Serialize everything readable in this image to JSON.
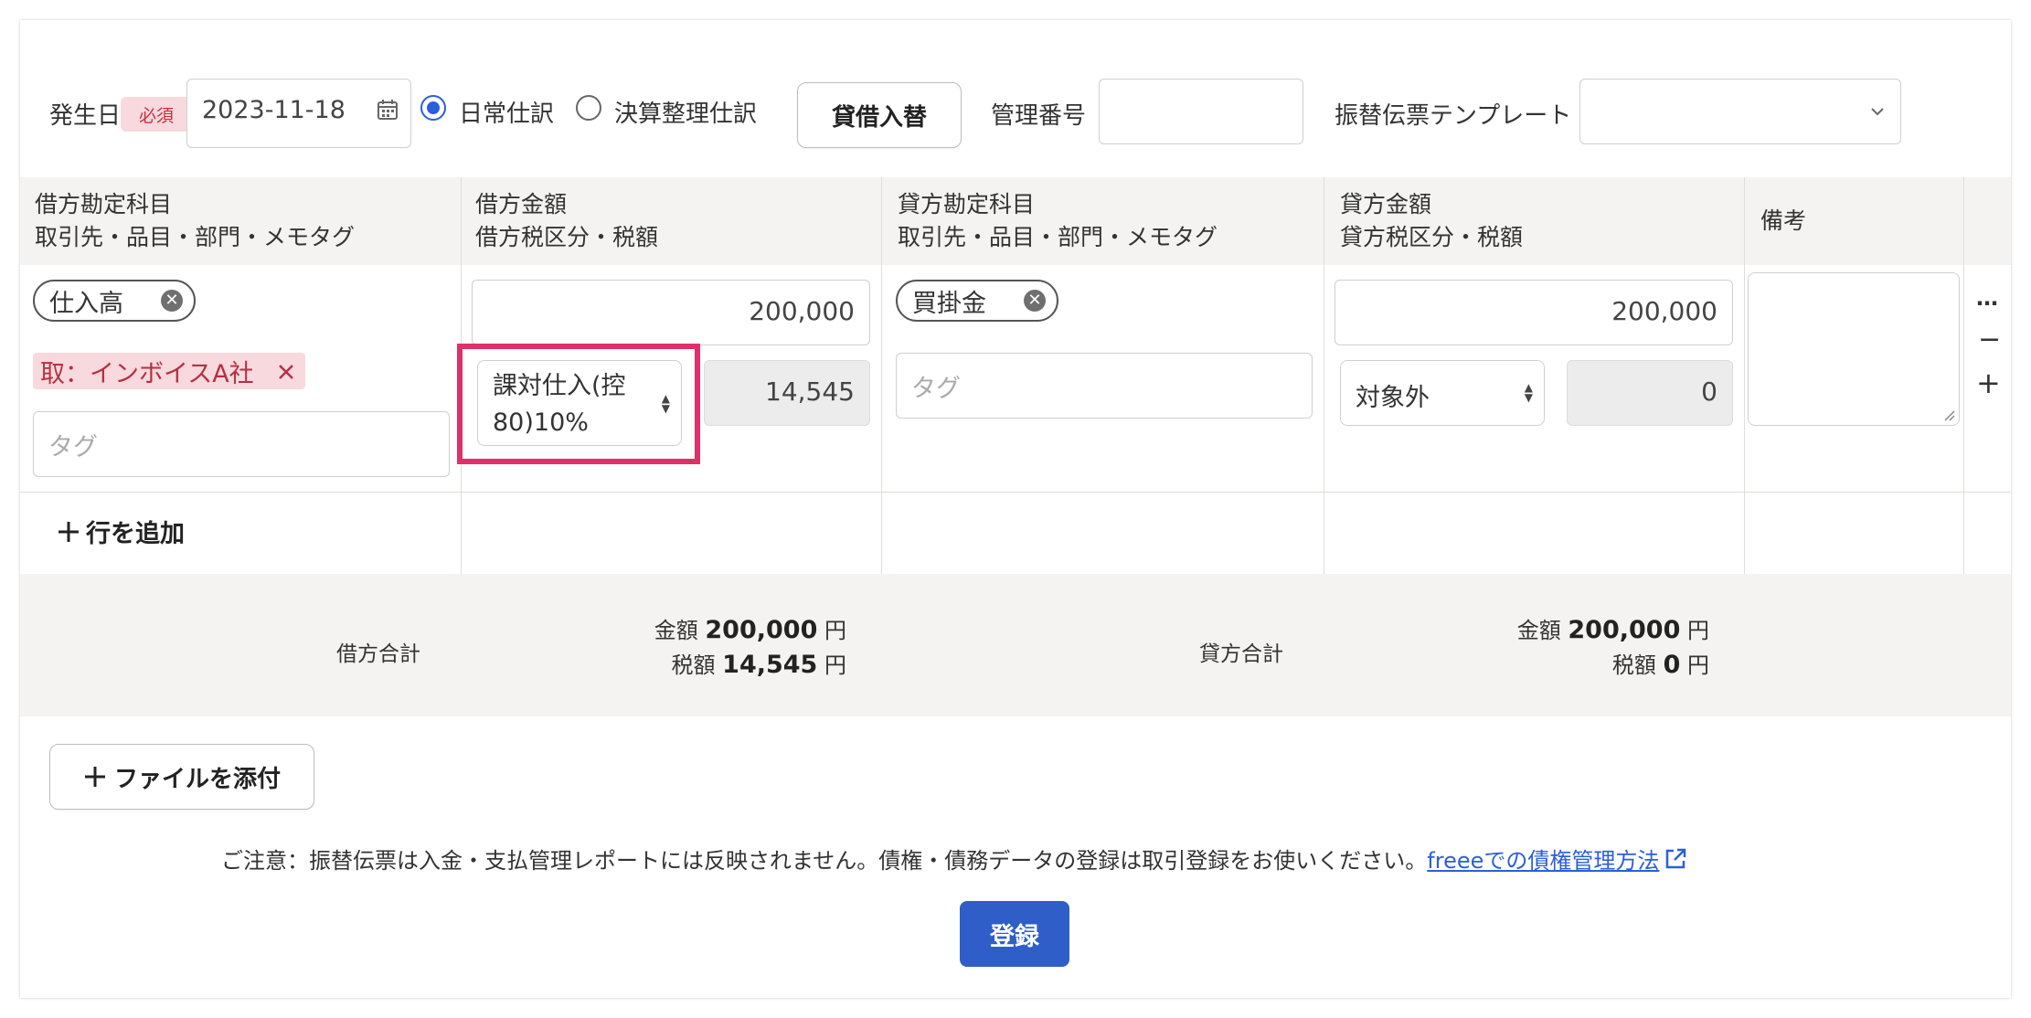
{
  "header": {
    "date_label": "発生日",
    "required_badge": "必須",
    "date_value": "2023-11-18",
    "entry_type_options": [
      "日常仕訳",
      "決算整理仕訳"
    ],
    "entry_type_selected": "日常仕訳",
    "swap_button": "貸借入替",
    "management_number_label": "管理番号",
    "management_number_value": "",
    "template_label": "振替伝票テンプレート",
    "template_value": ""
  },
  "table": {
    "columns": [
      {
        "line1": "借方勘定科目",
        "line2": "取引先・品目・部門・メモタグ"
      },
      {
        "line1": "借方金額",
        "line2": "借方税区分・税額"
      },
      {
        "line1": "貸方勘定科目",
        "line2": "取引先・品目・部門・メモタグ"
      },
      {
        "line1": "貸方金額",
        "line2": "貸方税区分・税額"
      },
      {
        "line1": "備考",
        "line2": ""
      }
    ],
    "row": {
      "debit_account": "仕入高",
      "debit_partner_tag": "取：インボイスA社",
      "debit_tag_placeholder": "タグ",
      "debit_amount": "200,000",
      "debit_tax_category": "課対仕入(控80)10%",
      "debit_tax_category_line1": "課対仕入(控",
      "debit_tax_category_line2": "80)10%",
      "debit_tax_amount": "14,545",
      "credit_account": "買掛金",
      "credit_tag_placeholder": "タグ",
      "credit_amount": "200,000",
      "credit_tax_category": "対象外",
      "credit_tax_amount": "0",
      "memo": ""
    },
    "row_actions": {
      "more": "…",
      "remove": "−",
      "add": "+"
    },
    "add_row": "行を追加"
  },
  "totals": {
    "debit_label": "借方合計",
    "credit_label": "貸方合計",
    "amount_label": "金額",
    "tax_label": "税額",
    "unit": "円",
    "debit_amount": "200,000",
    "debit_tax": "14,545",
    "credit_amount": "200,000",
    "credit_tax": "0"
  },
  "attach_button": "ファイルを添付",
  "notice": {
    "text": "ご注意：振替伝票は入金・支払管理レポートには反映されません。債権・債務データの登録は取引登録をお使いください。",
    "link": "freeeでの債権管理方法"
  },
  "submit_button": "登録",
  "colors": {
    "accent": "#2f5ec9",
    "highlight": "#e0306a",
    "required_bg": "#f8d9dd",
    "required_text": "#c8303f"
  }
}
